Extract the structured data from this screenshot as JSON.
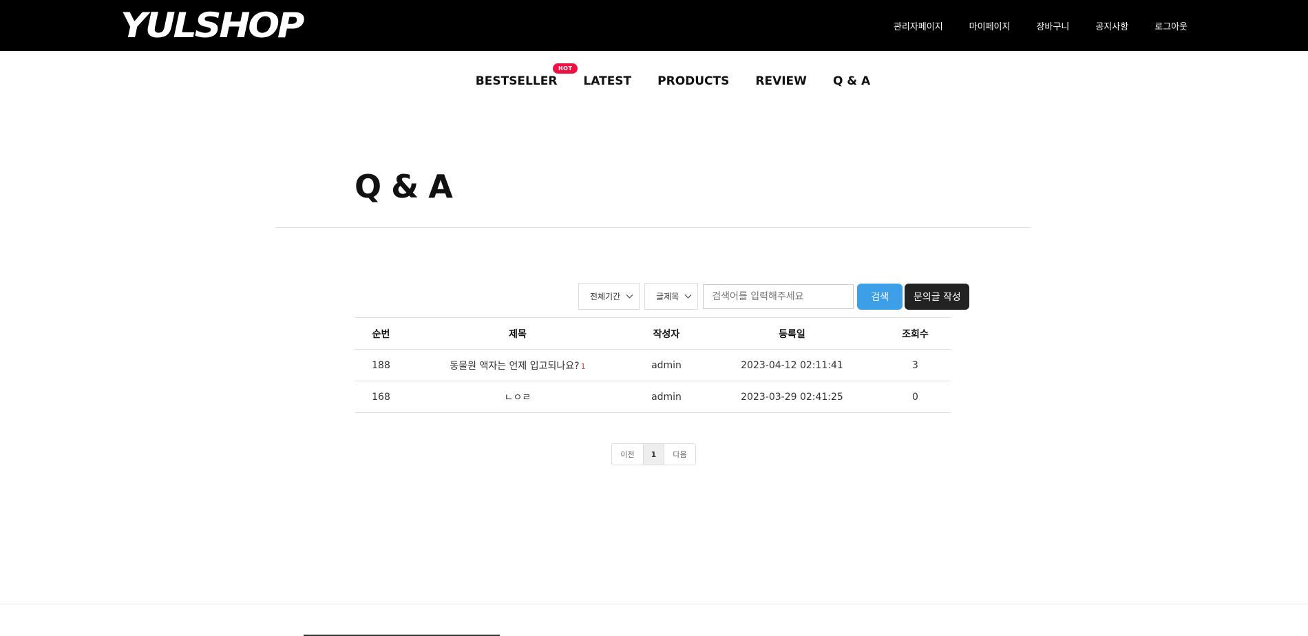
{
  "header": {
    "logo": "YULSHOP",
    "util_nav": [
      "관리자페이지",
      "마이페이지",
      "장바구니",
      "공지사항",
      "로그아웃"
    ]
  },
  "gnb": {
    "items": [
      "BESTSELLER",
      "LATEST",
      "PRODUCTS",
      "REVIEW",
      "Q & A"
    ],
    "hot_badge": "HOT"
  },
  "page": {
    "title": "Q & A"
  },
  "search": {
    "period": "전체기간",
    "field": "글제목",
    "placeholder": "검색어를 입력해주세요",
    "search_label": "검색",
    "write_label": "문의글 작성"
  },
  "board": {
    "headers": [
      "순번",
      "제목",
      "작성자",
      "등록일",
      "조회수"
    ],
    "rows": [
      {
        "no": "188",
        "title": "동물원 액자는 언제 입고되나요?",
        "comments": "1",
        "writer": "admin",
        "date": "2023-04-12 02:11:41",
        "views": "3"
      },
      {
        "no": "168",
        "title": "ㄴㅇㄹ",
        "comments": "",
        "writer": "admin",
        "date": "2023-03-29 02:41:25",
        "views": "0"
      }
    ]
  },
  "pagination": {
    "prev": "이전",
    "current": "1",
    "next": "다음"
  },
  "colors": {
    "topbar": "#000000",
    "hot_badge": "#ee1144",
    "search_button": "#3d9fe8",
    "write_button": "#222222"
  }
}
